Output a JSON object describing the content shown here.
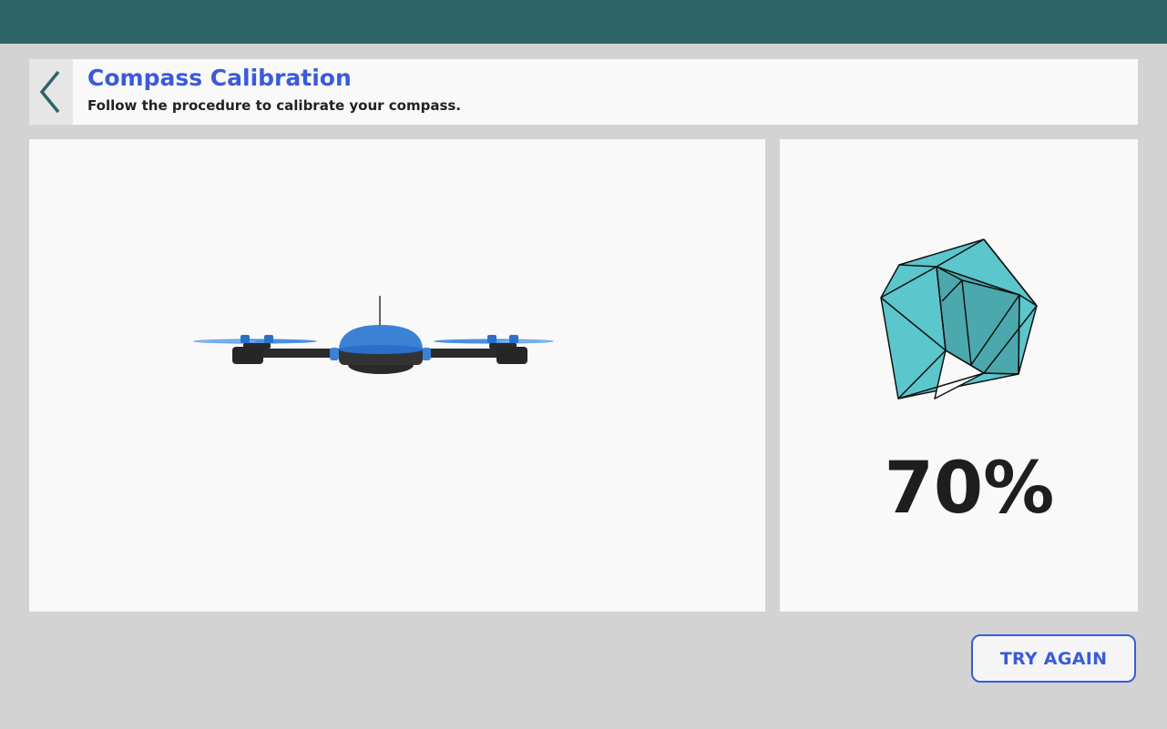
{
  "header": {
    "title": "Compass Calibration",
    "subtitle": "Follow the procedure to calibrate your compass."
  },
  "icons": {
    "back": "chevron-left-icon",
    "drone": "drone-illustration",
    "calibration": "icosahedron-calibration-icon"
  },
  "progress": {
    "percent_label": "70%",
    "percent_value": 70
  },
  "actions": {
    "try_again_label": "TRY AGAIN"
  },
  "colors": {
    "topbar": "#2d6468",
    "accent": "#3a5bd9",
    "shape_fill": "#5bc6cc",
    "drone_blue": "#3b82d6"
  }
}
